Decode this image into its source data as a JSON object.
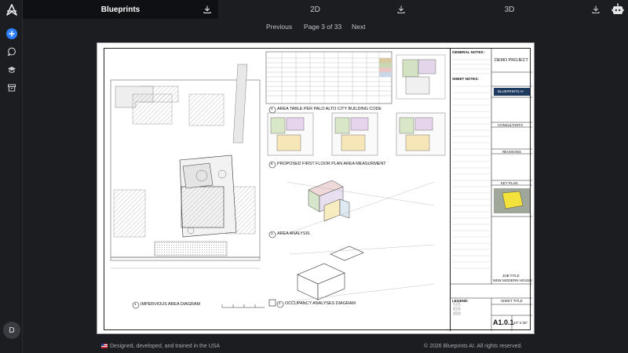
{
  "tabs": [
    {
      "label": "Blueprints",
      "active": true
    },
    {
      "label": "2D",
      "active": false
    },
    {
      "label": "3D",
      "active": false
    }
  ],
  "pager": {
    "previous": "Previous",
    "page_info": "Page 3 of 33",
    "next": "Next"
  },
  "user": {
    "initial": "D"
  },
  "footer": {
    "left": "Designed, developed, and trained in the USA",
    "right": "© 2026 Blueprints AI. All rights reserved."
  },
  "icons": {
    "logo": "blueprints-logo-icon",
    "new": "plus-icon",
    "chat": "chat-icon",
    "learn": "graduation-cap-icon",
    "archive": "archive-icon",
    "download": "download-icon",
    "bot": "robot-icon"
  },
  "colors": {
    "accent": "#2d7ff9",
    "background": "#1c1d21",
    "active_tab": "#0f1013"
  },
  "drawing": {
    "section_titles": {
      "area_table": "AREA TABLE PER PALO ALTO CITY BUILDING CODE",
      "floor_plan": "PROPOSED FIRST FLOOR PLAN AREA MEASURMENT",
      "area_analysis": "AREA ANALYSIS",
      "occupancy": "OCCUPANCY ANALYSES DIAGRAM",
      "impervious": "IMPERVIOUS AREA DIAGRAM"
    },
    "section_numbers": {
      "area_table": "4",
      "floor_plan": "5",
      "area_analysis": "3",
      "occupancy": "2",
      "impervious": "1"
    },
    "title_block": {
      "general_notes": "GENERAL NOTES:",
      "sheet_notes": "SHEET NOTES:",
      "project": "DEMO PROJECT",
      "brand": "BLUEPRINTS AI",
      "consultants": "CONSULTANTS",
      "revisions": "REVISIONS",
      "key_plan": "KEY PLAN",
      "job_title_label": "JOB TITLE",
      "job_title": "NEW MODERN HOUSE",
      "sheet_title_label": "SHEET TITLE",
      "sheet_number": "A1.0.1",
      "legend": "LEGEND:",
      "sheet_size": "24\" X 36\""
    }
  }
}
